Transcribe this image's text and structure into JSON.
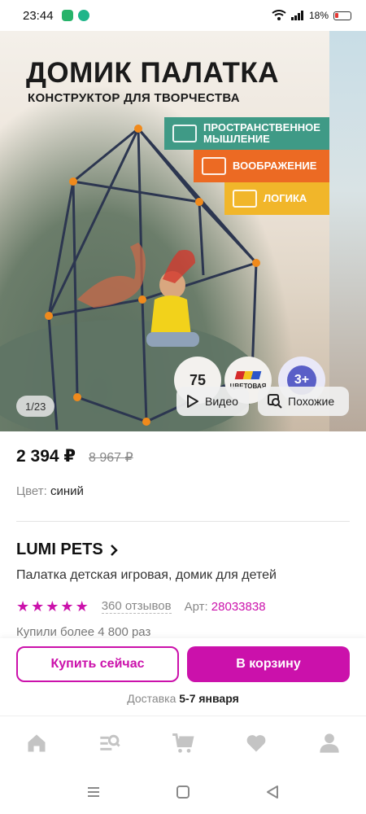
{
  "status_bar": {
    "time": "23:44",
    "battery": "18%"
  },
  "hero": {
    "title": "ДОМИК ПАЛАТКА",
    "subtitle": "КОНСТРУКТОР ДЛЯ ТВОРЧЕСТВА",
    "tags": [
      "ПРОСТРАНСТВЕННОЕ МЫШЛЕНИЕ",
      "ВООБРАЖЕНИЕ",
      "ЛОГИКА"
    ],
    "tag_colors": [
      "#3f9a86",
      "#ec6a23",
      "#f1b62a"
    ],
    "badge_count": "75",
    "badge_color_label": "ЦВЕТОВАЯ",
    "badge_age": "3+",
    "image_counter": "1/23",
    "video_label": "Видео",
    "similar_label": "Похожие"
  },
  "product": {
    "price": "2 394 ₽",
    "old_price": "8 967 ₽",
    "color_label": "Цвет:",
    "color_value": "синий",
    "brand": "LUMI PETS",
    "name": "Палатка детская игровая, домик для детей",
    "stars": 5,
    "reviews": "360 отзывов",
    "article_label": "Арт:",
    "article_value": "28033838",
    "bought": "Купили более 4 800 раз"
  },
  "actions": {
    "buy_now": "Купить сейчас",
    "add_to_cart": "В корзину",
    "delivery_label": "Доставка",
    "delivery_value": "5-7 января",
    "accent_color": "#cb11ab"
  },
  "bottom_nav": [
    "home-icon",
    "catalog-search-icon",
    "cart-icon",
    "heart-icon",
    "profile-icon"
  ],
  "system_nav": [
    "menu-icon",
    "home-square-icon",
    "back-icon"
  ]
}
